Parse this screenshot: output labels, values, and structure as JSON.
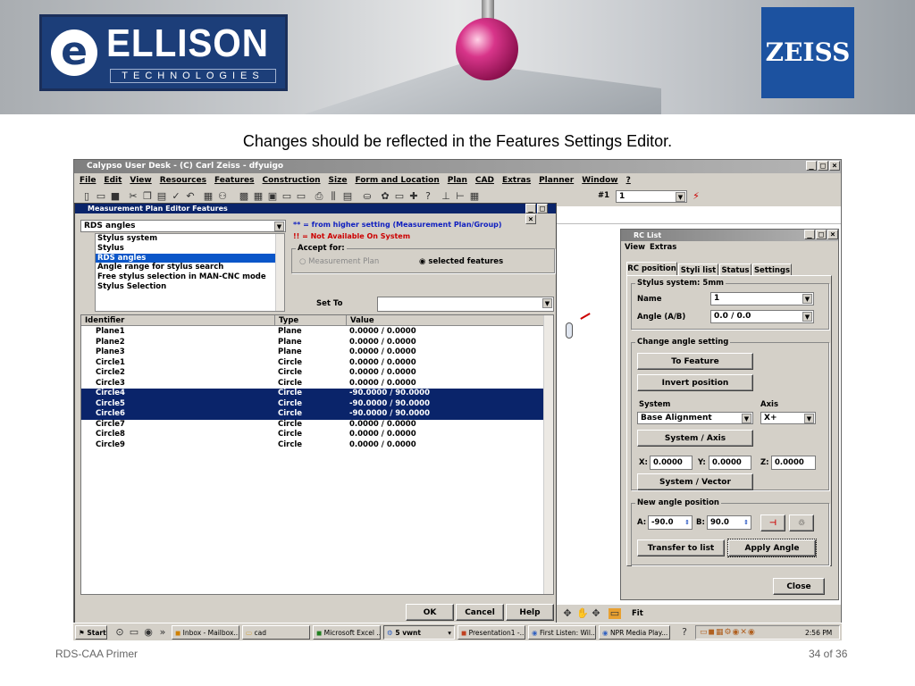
{
  "brand": {
    "ellison": "ELLISON",
    "ellison_sub": "TECHNOLOGIES",
    "zeiss": "ZEISS",
    "e_letter": "e"
  },
  "subtitle": "Changes should be reflected in the Features Settings Editor.",
  "desk": {
    "title": "Calypso User Desk - (C) Carl Zeiss - dfyuigo",
    "menu": [
      "File",
      "Edit",
      "View",
      "Resources",
      "Features",
      "Construction",
      "Size",
      "Form and Location",
      "Plan",
      "CAD",
      "Extras",
      "Planner",
      "Window",
      "?"
    ],
    "probe_label": "#1",
    "probe_value": "1",
    "fit_label": "Fit"
  },
  "mpef": {
    "title": "Measurement Plan Editor Features",
    "combo_value": "RDS angles",
    "legend1": "** = from higher setting (Measurement Plan/Group)",
    "legend2": "!! = Not Available On System",
    "list": [
      "Stylus system",
      "Stylus",
      "RDS angles",
      "Angle range for stylus search",
      "Free stylus selection in MAN-CNC mode",
      "Stylus Selection"
    ],
    "accept_for": "Accept for:",
    "opt_plan": "Measurement Plan",
    "opt_selected": "selected features",
    "set_to": "Set To",
    "col_identifier": "Identifier",
    "col_type": "Type",
    "col_value": "Value",
    "rows": [
      {
        "id": "Plane1",
        "type": "Plane",
        "value": "0.0000 / 0.0000"
      },
      {
        "id": "Plane2",
        "type": "Plane",
        "value": "0.0000 / 0.0000"
      },
      {
        "id": "Plane3",
        "type": "Plane",
        "value": "0.0000 / 0.0000"
      },
      {
        "id": "Circle1",
        "type": "Circle",
        "value": "0.0000 / 0.0000"
      },
      {
        "id": "Circle2",
        "type": "Circle",
        "value": "0.0000 / 0.0000"
      },
      {
        "id": "Circle3",
        "type": "Circle",
        "value": "0.0000 / 0.0000"
      },
      {
        "id": "Circle4",
        "type": "Circle",
        "value": "-90.0000 / 90.0000"
      },
      {
        "id": "Circle5",
        "type": "Circle",
        "value": "-90.0000 / 90.0000"
      },
      {
        "id": "Circle6",
        "type": "Circle",
        "value": "-90.0000 / 90.0000"
      },
      {
        "id": "Circle7",
        "type": "Circle",
        "value": "0.0000 / 0.0000"
      },
      {
        "id": "Circle8",
        "type": "Circle",
        "value": "0.0000 / 0.0000"
      },
      {
        "id": "Circle9",
        "type": "Circle",
        "value": "0.0000 / 0.0000"
      }
    ],
    "ok": "OK",
    "cancel": "Cancel",
    "help": "Help"
  },
  "rc": {
    "title": "RC List",
    "menu_view": "View",
    "menu_extras": "Extras",
    "tabs": [
      "RC position",
      "Styli list",
      "Status",
      "Settings"
    ],
    "stylus_system": "Stylus system: 5mm",
    "name_label": "Name",
    "name_value": "1",
    "angle_label": "Angle (A/B)",
    "angle_value": "0.0 / 0.0",
    "change_angle": "Change angle setting",
    "to_feature": "To Feature",
    "invert": "Invert position",
    "system_label": "System",
    "axis_label": "Axis",
    "system_value": "Base Alignment",
    "axis_value": "X+",
    "system_axis": "System / Axis",
    "x_label": "X:",
    "x_value": "0.0000",
    "y_label": "Y:",
    "y_value": "0.0000",
    "z_label": "Z:",
    "z_value": "0.0000",
    "system_vector": "System / Vector",
    "new_angle": "New angle position",
    "a_label": "A:",
    "a_value": "-90.0",
    "b_label": "B:",
    "b_value": "90.0",
    "transfer": "Transfer to list",
    "apply": "Apply Angle",
    "close": "Close"
  },
  "taskbar": {
    "start": "Start",
    "clock": "2:56 PM",
    "tasks": [
      "Inbox - Mailbox...",
      "cad",
      "Microsoft Excel ...",
      "5 vwnt",
      "Presentation1 -...",
      "First Listen: Wil...",
      "NPR Media Play..."
    ]
  },
  "footer": {
    "left": "RDS-CAA Primer",
    "right": "34 of 36"
  }
}
